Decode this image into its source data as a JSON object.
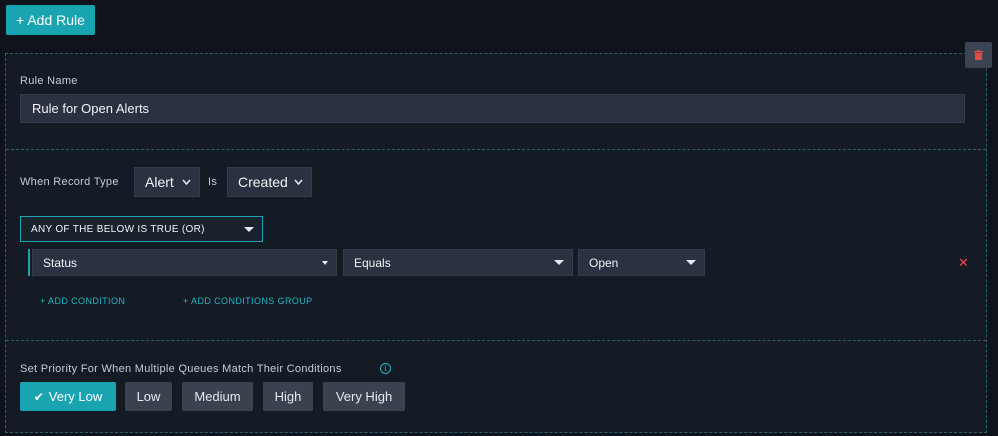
{
  "toolbar": {
    "add_rule_label": "+ Add Rule"
  },
  "rule": {
    "name_label": "Rule Name",
    "name_value": "Rule for Open Alerts",
    "when_label": "When Record Type",
    "record_type": "Alert",
    "is_label": "Is",
    "event": "Created",
    "logic": "ANY OF THE BELOW IS TRUE (OR)",
    "condition": {
      "field": "Status",
      "operator": "Equals",
      "value": "Open"
    },
    "add_condition": "+ ADD CONDITION",
    "add_group": "+ ADD CONDITIONS GROUP"
  },
  "priority": {
    "label": "Set Priority For When Multiple Queues Match Their Conditions",
    "info_glyph": "i",
    "options": [
      "Very Low",
      "Low",
      "Medium",
      "High",
      "Very High"
    ],
    "selected": "Very Low"
  },
  "colors": {
    "accent": "#1aa3b1",
    "delete": "#e34b4b"
  }
}
